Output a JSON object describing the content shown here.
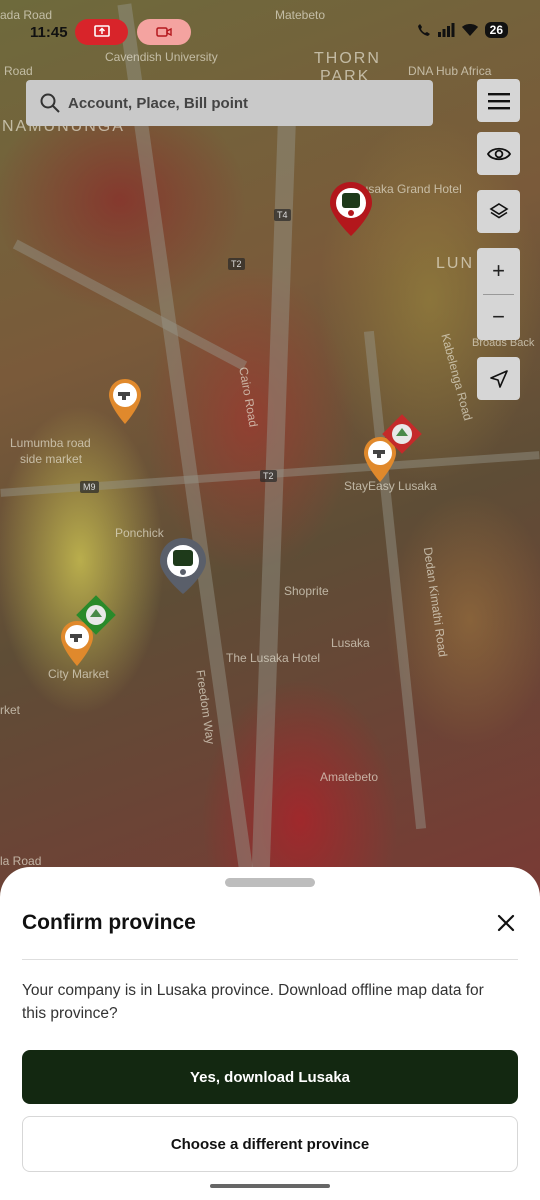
{
  "status_bar": {
    "time": "11:45",
    "battery": "26",
    "icons": [
      "screen-share-icon",
      "video-call-icon",
      "call-icon",
      "signal-icon",
      "wifi-icon",
      "battery-icon"
    ]
  },
  "search": {
    "placeholder": "Account, Place, Bill point",
    "icon": "search-icon"
  },
  "map_controls": {
    "menu_icon": "menu-icon",
    "visibility_icon": "eye-icon",
    "layers_icon": "layers-icon",
    "zoom_in": "+",
    "zoom_out": "−",
    "locate_icon": "navigation-arrow-icon"
  },
  "map": {
    "labels": [
      "ada Road",
      "Road",
      "Cavendish University",
      "Matebeto",
      "THORN",
      "PARK",
      "DNA Hub Africa",
      "NAMUNUNGA",
      "Lusaka Grand Hotel",
      "LUN",
      "Broads Back",
      "Cairo Road",
      "Kabelenga Road",
      "Lumumba road",
      "side market",
      "StayEasy Lusaka",
      "Ponchick",
      "Shoprite",
      "Dedan Kimathi Road",
      "Lusaka",
      "City Market",
      "The Lusaka Hotel",
      "Freedom Way",
      "rket",
      "Amatebeto",
      "la Road"
    ],
    "shields": [
      "T4",
      "T2",
      "T2",
      "M9"
    ]
  },
  "sheet": {
    "title": "Confirm province",
    "message": "Your company is in Lusaka province. Download offline map data for this province?",
    "primary_button": "Yes, download Lusaka",
    "secondary_button": "Choose a different province",
    "close_icon": "close-icon"
  },
  "colors": {
    "primary": "#132811",
    "sheet_bg": "#ffffff",
    "pin_orange": "#e0892c",
    "pin_red": "#b3171c",
    "pin_gray": "#5a5f6a",
    "diamond_green": "#2a8a2a",
    "diamond_red": "#c42a2a"
  }
}
